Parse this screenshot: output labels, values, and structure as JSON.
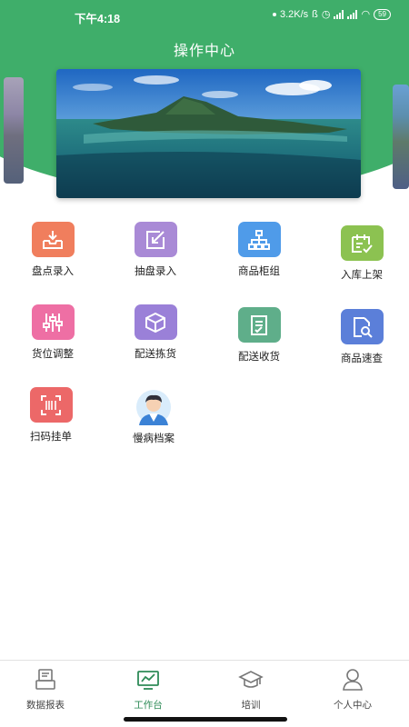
{
  "status_bar": {
    "time": "下午4:18",
    "network_speed": "3.2K/s",
    "battery": "59"
  },
  "header": {
    "title": "操作中心"
  },
  "apps": [
    {
      "label": "盘点录入",
      "icon": "inbox-download-icon",
      "color": "#f07e5d"
    },
    {
      "label": "抽盘录入",
      "icon": "edit-square-icon",
      "color": "#a98ad6"
    },
    {
      "label": "商品柜组",
      "icon": "org-tree-icon",
      "color": "#4f9be9"
    },
    {
      "label": "入库上架",
      "icon": "calendar-check-icon",
      "color": "#8cc251"
    },
    {
      "label": "货位调整",
      "icon": "sliders-icon",
      "color": "#ee6fa4"
    },
    {
      "label": "配送拣货",
      "icon": "box-icon",
      "color": "#9a80d8"
    },
    {
      "label": "配送收货",
      "icon": "checklist-icon",
      "color": "#5fae8a"
    },
    {
      "label": "商品速查",
      "icon": "doc-search-icon",
      "color": "#5b7fd9"
    },
    {
      "label": "扫码挂单",
      "icon": "barcode-scan-icon",
      "color": "#ec6868"
    },
    {
      "label": "慢病档案",
      "icon": "doctor-avatar-icon",
      "color": "#7fb8e8"
    }
  ],
  "tabbar": {
    "items": [
      {
        "label": "数据报表",
        "icon": "report-icon",
        "active": false
      },
      {
        "label": "工作台",
        "icon": "workbench-chart-icon",
        "active": true
      },
      {
        "label": "培训",
        "icon": "graduation-cap-icon",
        "active": false
      },
      {
        "label": "个人中心",
        "icon": "user-icon",
        "active": false
      }
    ]
  },
  "colors": {
    "header_green": "#3fae6a",
    "active_tab": "#2e8b57"
  }
}
